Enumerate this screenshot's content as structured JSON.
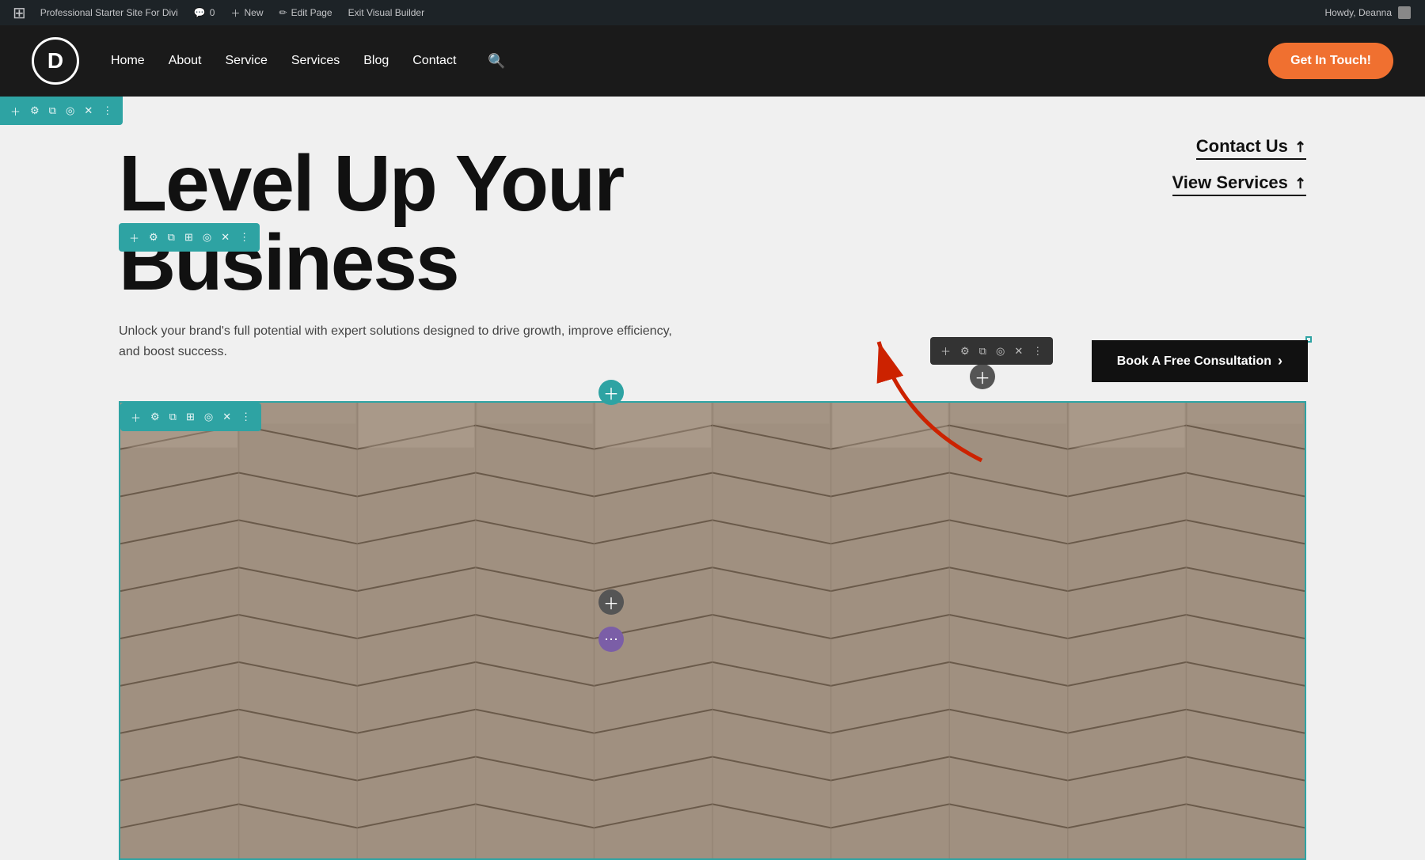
{
  "admin_bar": {
    "site_title": "Professional Starter Site For Divi",
    "comment_count": "0",
    "new_label": "New",
    "new_badge": "New",
    "edit_page": "Edit Page",
    "exit_builder": "Exit Visual Builder",
    "howdy": "Howdy, Deanna"
  },
  "site_header": {
    "logo_letter": "D",
    "nav": {
      "home": "Home",
      "about": "About",
      "service": "Service",
      "services": "Services",
      "blog": "Blog",
      "contact": "Contact"
    },
    "cta_button": "Get In Touch!"
  },
  "hero": {
    "headline_line1": "Level Up Your",
    "headline_line2": "Business",
    "subtext": "Unlock your brand's full potential with expert solutions designed to drive growth, improve efficiency, and boost success.",
    "link_contact": "Contact Us",
    "link_services": "View Services",
    "cta_button": "Book A Free Consultation",
    "cta_arrow": "›"
  },
  "builder": {
    "toolbar_icons": [
      "＋",
      "⚙",
      "⧉",
      "◎",
      "✕",
      "⋮"
    ],
    "module_toolbar_icons": [
      "＋",
      "⚙",
      "⧉",
      "◎",
      "✕",
      "⋮"
    ]
  },
  "colors": {
    "teal": "#2ea3a3",
    "orange": "#f07030",
    "dark": "#1a1a1a",
    "dark_text": "#111111",
    "purple": "#7b5ea7"
  }
}
